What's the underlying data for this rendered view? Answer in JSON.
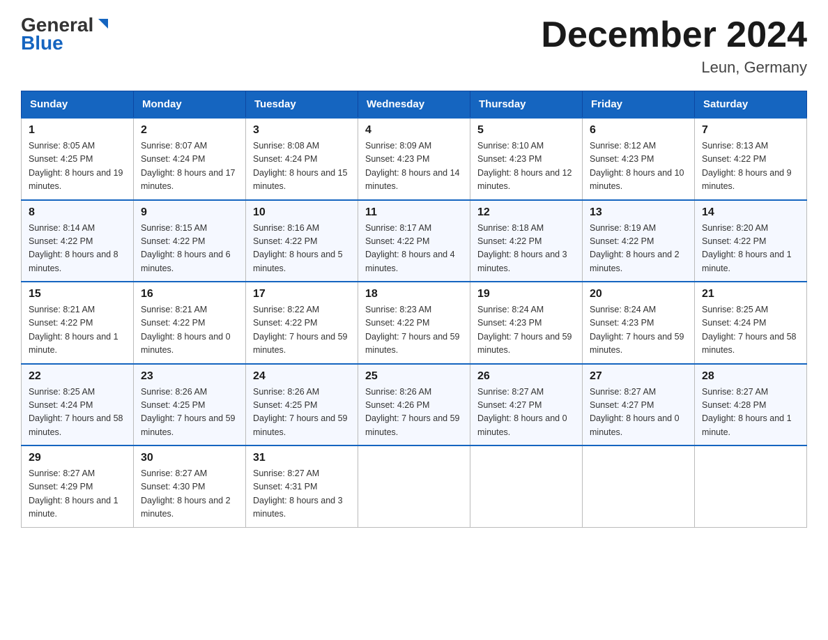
{
  "header": {
    "logo_general": "General",
    "logo_blue": "Blue",
    "month_title": "December 2024",
    "location": "Leun, Germany"
  },
  "days_of_week": [
    "Sunday",
    "Monday",
    "Tuesday",
    "Wednesday",
    "Thursday",
    "Friday",
    "Saturday"
  ],
  "weeks": [
    [
      {
        "day": "1",
        "sunrise": "8:05 AM",
        "sunset": "4:25 PM",
        "daylight": "8 hours and 19 minutes."
      },
      {
        "day": "2",
        "sunrise": "8:07 AM",
        "sunset": "4:24 PM",
        "daylight": "8 hours and 17 minutes."
      },
      {
        "day": "3",
        "sunrise": "8:08 AM",
        "sunset": "4:24 PM",
        "daylight": "8 hours and 15 minutes."
      },
      {
        "day": "4",
        "sunrise": "8:09 AM",
        "sunset": "4:23 PM",
        "daylight": "8 hours and 14 minutes."
      },
      {
        "day": "5",
        "sunrise": "8:10 AM",
        "sunset": "4:23 PM",
        "daylight": "8 hours and 12 minutes."
      },
      {
        "day": "6",
        "sunrise": "8:12 AM",
        "sunset": "4:23 PM",
        "daylight": "8 hours and 10 minutes."
      },
      {
        "day": "7",
        "sunrise": "8:13 AM",
        "sunset": "4:22 PM",
        "daylight": "8 hours and 9 minutes."
      }
    ],
    [
      {
        "day": "8",
        "sunrise": "8:14 AM",
        "sunset": "4:22 PM",
        "daylight": "8 hours and 8 minutes."
      },
      {
        "day": "9",
        "sunrise": "8:15 AM",
        "sunset": "4:22 PM",
        "daylight": "8 hours and 6 minutes."
      },
      {
        "day": "10",
        "sunrise": "8:16 AM",
        "sunset": "4:22 PM",
        "daylight": "8 hours and 5 minutes."
      },
      {
        "day": "11",
        "sunrise": "8:17 AM",
        "sunset": "4:22 PM",
        "daylight": "8 hours and 4 minutes."
      },
      {
        "day": "12",
        "sunrise": "8:18 AM",
        "sunset": "4:22 PM",
        "daylight": "8 hours and 3 minutes."
      },
      {
        "day": "13",
        "sunrise": "8:19 AM",
        "sunset": "4:22 PM",
        "daylight": "8 hours and 2 minutes."
      },
      {
        "day": "14",
        "sunrise": "8:20 AM",
        "sunset": "4:22 PM",
        "daylight": "8 hours and 1 minute."
      }
    ],
    [
      {
        "day": "15",
        "sunrise": "8:21 AM",
        "sunset": "4:22 PM",
        "daylight": "8 hours and 1 minute."
      },
      {
        "day": "16",
        "sunrise": "8:21 AM",
        "sunset": "4:22 PM",
        "daylight": "8 hours and 0 minutes."
      },
      {
        "day": "17",
        "sunrise": "8:22 AM",
        "sunset": "4:22 PM",
        "daylight": "7 hours and 59 minutes."
      },
      {
        "day": "18",
        "sunrise": "8:23 AM",
        "sunset": "4:22 PM",
        "daylight": "7 hours and 59 minutes."
      },
      {
        "day": "19",
        "sunrise": "8:24 AM",
        "sunset": "4:23 PM",
        "daylight": "7 hours and 59 minutes."
      },
      {
        "day": "20",
        "sunrise": "8:24 AM",
        "sunset": "4:23 PM",
        "daylight": "7 hours and 59 minutes."
      },
      {
        "day": "21",
        "sunrise": "8:25 AM",
        "sunset": "4:24 PM",
        "daylight": "7 hours and 58 minutes."
      }
    ],
    [
      {
        "day": "22",
        "sunrise": "8:25 AM",
        "sunset": "4:24 PM",
        "daylight": "7 hours and 58 minutes."
      },
      {
        "day": "23",
        "sunrise": "8:26 AM",
        "sunset": "4:25 PM",
        "daylight": "7 hours and 59 minutes."
      },
      {
        "day": "24",
        "sunrise": "8:26 AM",
        "sunset": "4:25 PM",
        "daylight": "7 hours and 59 minutes."
      },
      {
        "day": "25",
        "sunrise": "8:26 AM",
        "sunset": "4:26 PM",
        "daylight": "7 hours and 59 minutes."
      },
      {
        "day": "26",
        "sunrise": "8:27 AM",
        "sunset": "4:27 PM",
        "daylight": "8 hours and 0 minutes."
      },
      {
        "day": "27",
        "sunrise": "8:27 AM",
        "sunset": "4:27 PM",
        "daylight": "8 hours and 0 minutes."
      },
      {
        "day": "28",
        "sunrise": "8:27 AM",
        "sunset": "4:28 PM",
        "daylight": "8 hours and 1 minute."
      }
    ],
    [
      {
        "day": "29",
        "sunrise": "8:27 AM",
        "sunset": "4:29 PM",
        "daylight": "8 hours and 1 minute."
      },
      {
        "day": "30",
        "sunrise": "8:27 AM",
        "sunset": "4:30 PM",
        "daylight": "8 hours and 2 minutes."
      },
      {
        "day": "31",
        "sunrise": "8:27 AM",
        "sunset": "4:31 PM",
        "daylight": "8 hours and 3 minutes."
      },
      null,
      null,
      null,
      null
    ]
  ]
}
